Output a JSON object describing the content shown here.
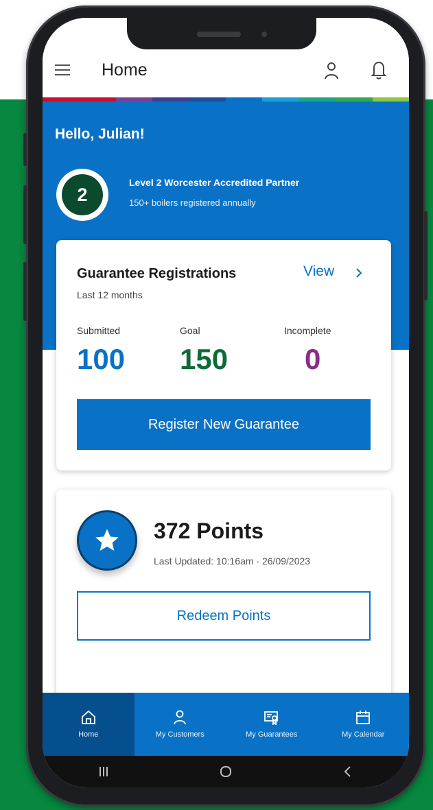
{
  "app_bar": {
    "title": "Home",
    "icons": [
      "menu-icon",
      "user-icon",
      "bell-icon"
    ]
  },
  "brand_stripe_colors": [
    "#c8102e",
    "#c8102e",
    "#7b3f98",
    "#3d3f8f",
    "#1e4f9c",
    "#0a72c6",
    "#1a9fd6",
    "#1aa78a",
    "#33a852",
    "#8dc63f"
  ],
  "greeting": "Hello, Julian!",
  "partner": {
    "level": "2",
    "title": "Level 2 Worcester Accredited Partner",
    "subtitle": "150+ boilers registered annually"
  },
  "registrations": {
    "title": "Guarantee Registrations",
    "period": "Last 12 months",
    "view_label": "View",
    "stats": [
      {
        "label": "Submitted",
        "value": "100",
        "color": "#0a72c6"
      },
      {
        "label": "Goal",
        "value": "150",
        "color": "#0d6b3a"
      },
      {
        "label": "Incomplete",
        "value": "0",
        "color": "#8a2a8a"
      }
    ],
    "register_button": "Register New Guarantee"
  },
  "points": {
    "value": "372 Points",
    "updated": "Last Updated: 10:16am - 26/09/2023",
    "redeem_button": "Redeem Points",
    "icon": "star-icon"
  },
  "bottom_nav": [
    {
      "label": "Home",
      "icon": "home-icon",
      "active": true
    },
    {
      "label": "My Customers",
      "icon": "user-icon",
      "active": false
    },
    {
      "label": "My Guarantees",
      "icon": "certificate-icon",
      "active": false
    },
    {
      "label": "My Calendar",
      "icon": "calendar-icon",
      "active": false
    }
  ],
  "system_nav": [
    "recents-icon",
    "home-circle-icon",
    "back-icon"
  ],
  "colors": {
    "brand_blue": "#0a72c6",
    "background_green": "#07873f",
    "badge_green": "#0b4a2c"
  }
}
